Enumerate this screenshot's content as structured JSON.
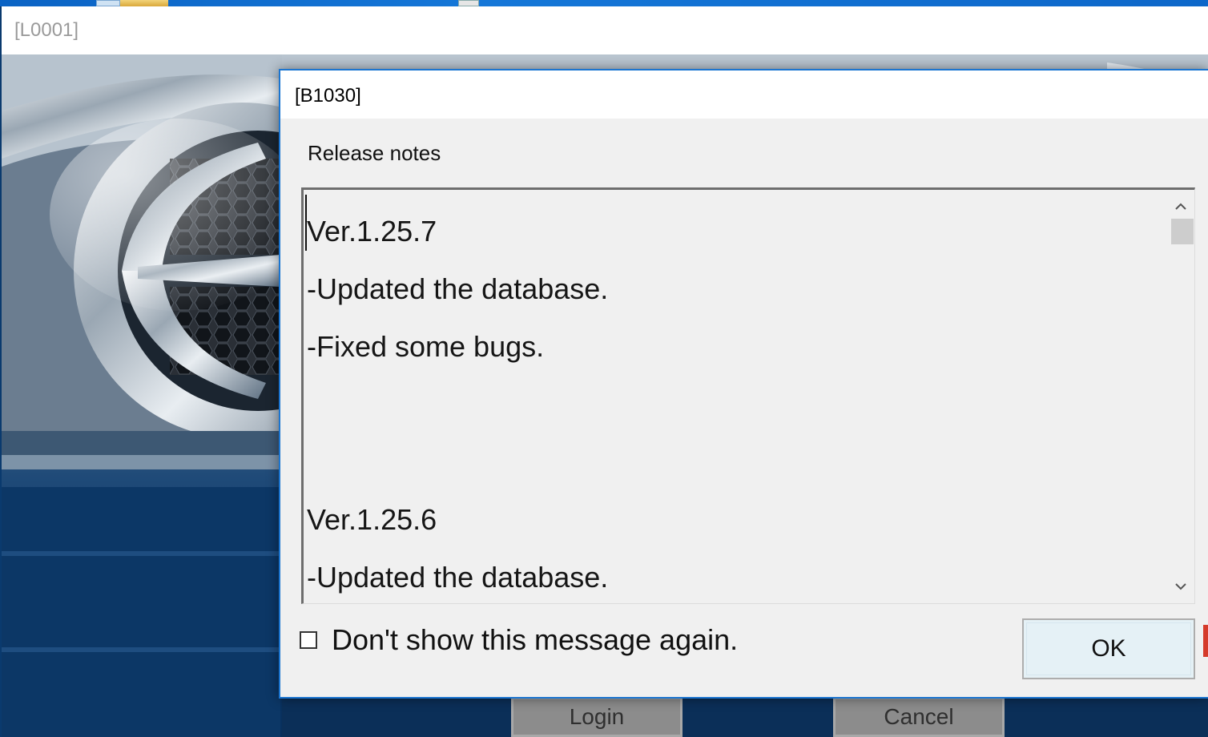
{
  "main_window": {
    "title": "[L0001]",
    "buttons": {
      "login_label": "Login",
      "cancel_label": "Cancel"
    }
  },
  "dialog": {
    "title": "[B1030]",
    "section_label": "Release notes",
    "notes": [
      "Ver.1.25.7",
      "-Updated the database.",
      "-Fixed some bugs.",
      "",
      "",
      "Ver.1.25.6",
      "-Updated the database."
    ],
    "checkbox_label": "Don't show this message again.",
    "checkbox_checked": false,
    "ok_label": "OK",
    "scroll_up_icon": "chevron-up-icon",
    "scroll_down_icon": "chevron-down-icon"
  },
  "colors": {
    "dialog_border": "#1b75d0",
    "ok_button_bg": "#e5f1f6"
  }
}
